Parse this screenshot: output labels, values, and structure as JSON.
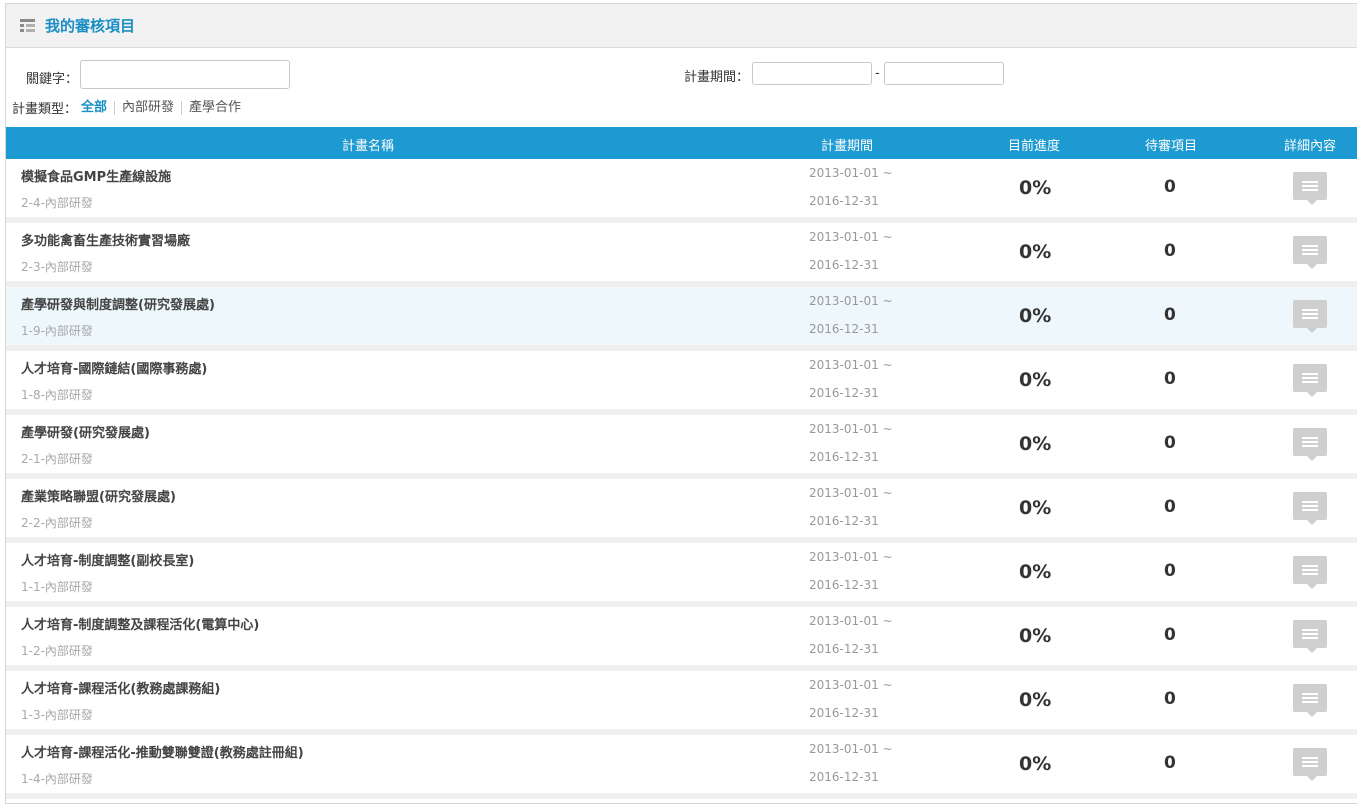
{
  "header": {
    "title": "我的審核項目"
  },
  "filters": {
    "keyword_label": "關鍵字：",
    "keyword_value": "",
    "period_label": "計畫期間：",
    "period_from": "",
    "period_to": "",
    "period_separator": "-",
    "type_label": "計畫類型：",
    "types": [
      {
        "label": "全部",
        "active": true
      },
      {
        "label": "內部研發",
        "active": false
      },
      {
        "label": "產學合作",
        "active": false
      }
    ]
  },
  "table": {
    "columns": [
      "計畫名稱",
      "計畫期間",
      "目前進度",
      "待審項目",
      "詳細內容"
    ],
    "rows": [
      {
        "name": "模擬食品GMP生產線設施",
        "code": "2-4-內部研發",
        "start": "2013-01-01 ~",
        "end": "2016-12-31",
        "progress": "0%",
        "pending": "0"
      },
      {
        "name": "多功能禽畜生產技術實習場廠",
        "code": "2-3-內部研發",
        "start": "2013-01-01 ~",
        "end": "2016-12-31",
        "progress": "0%",
        "pending": "0"
      },
      {
        "name": "產學研發與制度調整(研究發展處)",
        "code": "1-9-內部研發",
        "start": "2013-01-01 ~",
        "end": "2016-12-31",
        "progress": "0%",
        "pending": "0"
      },
      {
        "name": "人才培育-國際鏈結(國際事務處)",
        "code": "1-8-內部研發",
        "start": "2013-01-01 ~",
        "end": "2016-12-31",
        "progress": "0%",
        "pending": "0"
      },
      {
        "name": "產學研發(研究發展處)",
        "code": "2-1-內部研發",
        "start": "2013-01-01 ~",
        "end": "2016-12-31",
        "progress": "0%",
        "pending": "0"
      },
      {
        "name": "產業策略聯盟(研究發展處)",
        "code": "2-2-內部研發",
        "start": "2013-01-01 ~",
        "end": "2016-12-31",
        "progress": "0%",
        "pending": "0"
      },
      {
        "name": "人才培育-制度調整(副校長室)",
        "code": "1-1-內部研發",
        "start": "2013-01-01 ~",
        "end": "2016-12-31",
        "progress": "0%",
        "pending": "0"
      },
      {
        "name": "人才培育-制度調整及課程活化(電算中心)",
        "code": "1-2-內部研發",
        "start": "2013-01-01 ~",
        "end": "2016-12-31",
        "progress": "0%",
        "pending": "0"
      },
      {
        "name": "人才培育-課程活化(教務處課務組)",
        "code": "1-3-內部研發",
        "start": "2013-01-01 ~",
        "end": "2016-12-31",
        "progress": "0%",
        "pending": "0"
      },
      {
        "name": "人才培育-課程活化-推動雙聯雙證(教務處註冊組)",
        "code": "1-4-內部研發",
        "start": "2013-01-01 ~",
        "end": "2016-12-31",
        "progress": "0%",
        "pending": "0"
      }
    ]
  },
  "colors": {
    "accent": "#1d9ad1",
    "title": "#1a8ec5",
    "highlight_row": "#eef7fc"
  },
  "icons": {
    "header": "list-icon",
    "detail": "comment-icon"
  }
}
